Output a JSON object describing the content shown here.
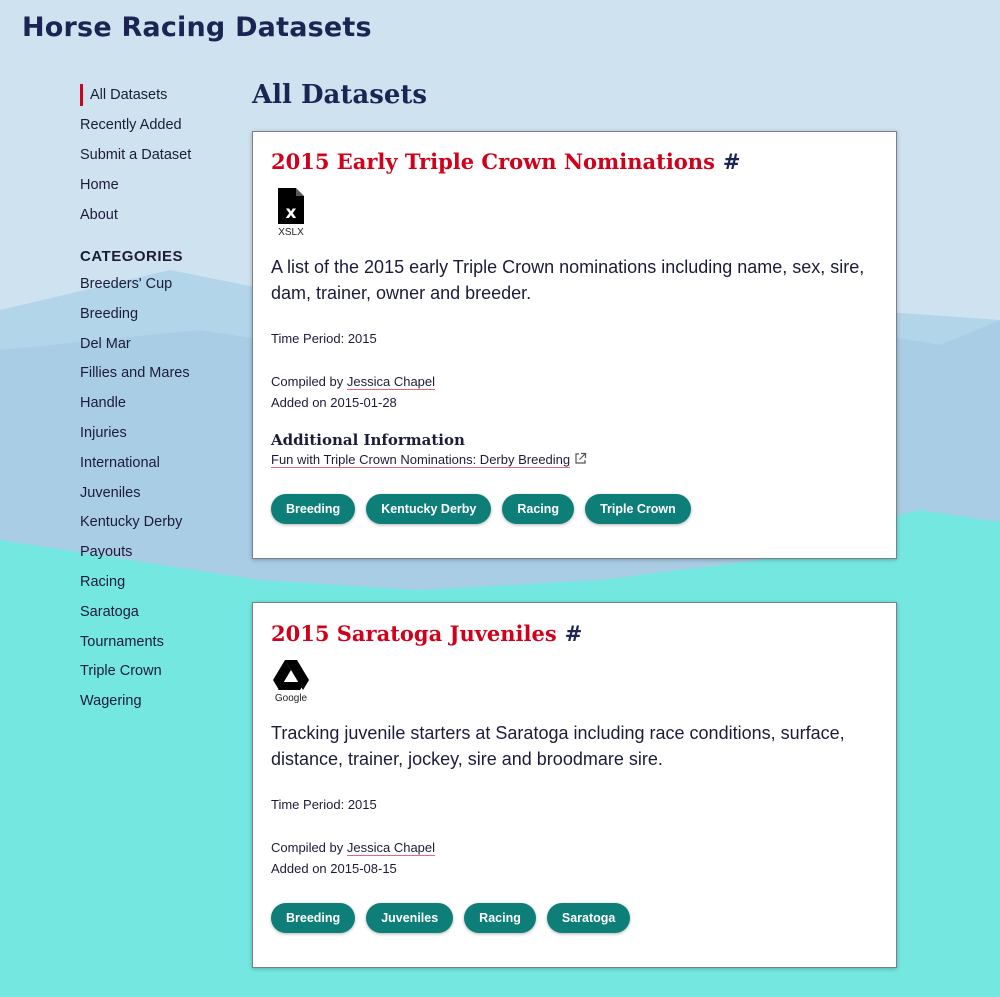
{
  "site": {
    "title": "Horse Racing Datasets"
  },
  "sidebar": {
    "nav": [
      {
        "label": "All Datasets",
        "active": true
      },
      {
        "label": "Recently Added"
      },
      {
        "label": "Submit a Dataset"
      },
      {
        "label": "Home"
      },
      {
        "label": "About"
      }
    ],
    "categories_heading": "CATEGORIES",
    "categories": [
      "Breeders' Cup",
      "Breeding",
      "Del Mar",
      "Fillies and Mares",
      "Handle",
      "Injuries",
      "International",
      "Juveniles",
      "Kentucky Derby",
      "Payouts",
      "Racing",
      "Saratoga",
      "Tournaments",
      "Triple Crown",
      "Wagering"
    ]
  },
  "main": {
    "heading": "All Datasets",
    "datasets": [
      {
        "title": "2015 Early Triple Crown Nominations",
        "anchor": "#",
        "file_type": "XSLX",
        "file_icon": "excel-file-icon",
        "description": "A list of the 2015 early Triple Crown nominations including name, sex, sire, dam, trainer, owner and breeder.",
        "time_period": "Time Period: 2015",
        "compiled_prefix": "Compiled by ",
        "compiled_by": "Jessica Chapel",
        "added": "Added on 2015-01-28",
        "additional_heading": "Additional Information",
        "additional_link": "Fun with Triple Crown Nominations: Derby Breeding",
        "tags": [
          "Breeding",
          "Kentucky Derby",
          "Racing",
          "Triple Crown"
        ]
      },
      {
        "title": "2015 Saratoga Juveniles",
        "anchor": "#",
        "file_type": "Google",
        "file_icon": "google-drive-icon",
        "description": "Tracking juvenile starters at Saratoga including race conditions, surface, distance, trainer, jockey, sire and broodmare sire.",
        "time_period": "Time Period: 2015",
        "compiled_prefix": "Compiled by ",
        "compiled_by": "Jessica Chapel",
        "added": "Added on 2015-08-15",
        "tags": [
          "Breeding",
          "Juveniles",
          "Racing",
          "Saratoga"
        ]
      }
    ]
  },
  "colors": {
    "accent_red": "#d0021b",
    "tag_teal": "#0e7f78",
    "sky": "#cfe2ef",
    "mountain": "#a9cde4",
    "ground": "#74e8e0",
    "title_navy": "#1b2452"
  }
}
